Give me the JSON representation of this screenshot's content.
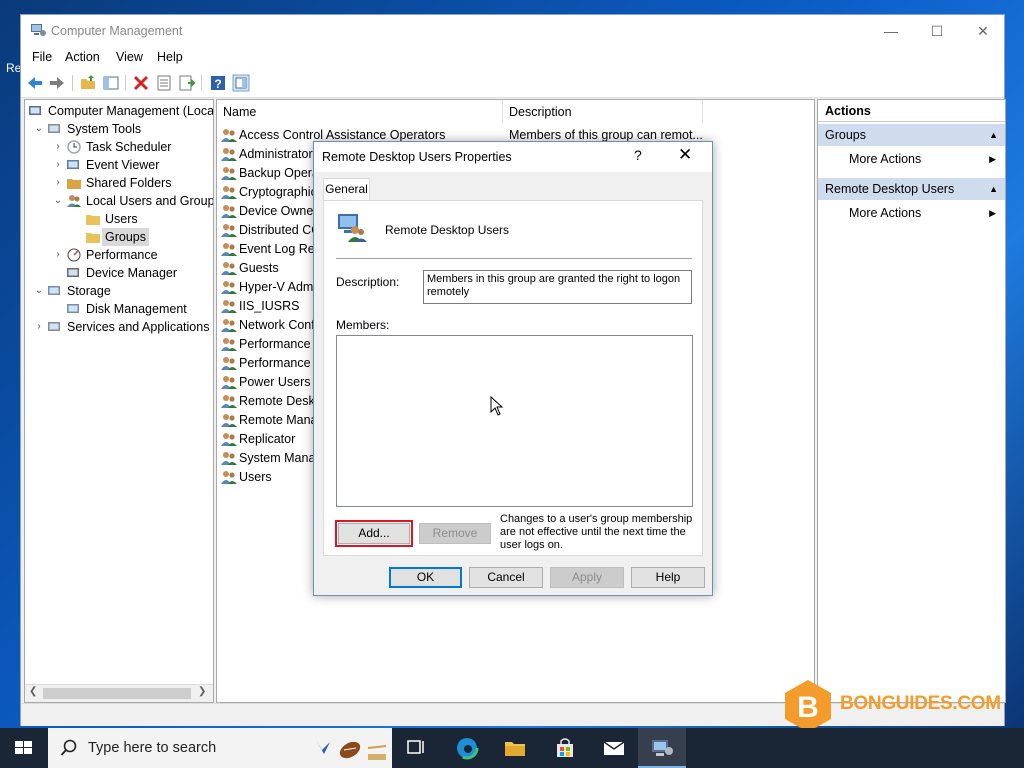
{
  "window": {
    "title": "Computer Management",
    "controls": {
      "minimize": "—",
      "maximize": "☐",
      "close": "✕"
    }
  },
  "menu": [
    "File",
    "Action",
    "View",
    "Help"
  ],
  "tree": [
    {
      "label": "Computer Management (Local",
      "level": 0,
      "expander": "",
      "icon": "computer-management-icon"
    },
    {
      "label": "System Tools",
      "level": 1,
      "expander": "⌄",
      "icon": "tools-icon"
    },
    {
      "label": "Task Scheduler",
      "level": 2,
      "expander": "›",
      "icon": "clock-icon"
    },
    {
      "label": "Event Viewer",
      "level": 2,
      "expander": "›",
      "icon": "event-viewer-icon"
    },
    {
      "label": "Shared Folders",
      "level": 2,
      "expander": "›",
      "icon": "shared-folder-icon"
    },
    {
      "label": "Local Users and Groups",
      "level": 2,
      "expander": "⌄",
      "icon": "users-icon"
    },
    {
      "label": "Users",
      "level": 3,
      "expander": "",
      "icon": "folder-icon"
    },
    {
      "label": "Groups",
      "level": 3,
      "expander": "",
      "icon": "folder-icon",
      "selected": true
    },
    {
      "label": "Performance",
      "level": 2,
      "expander": "›",
      "icon": "performance-icon"
    },
    {
      "label": "Device Manager",
      "level": 2,
      "expander": "",
      "icon": "device-manager-icon"
    },
    {
      "label": "Storage",
      "level": 1,
      "expander": "⌄",
      "icon": "storage-icon"
    },
    {
      "label": "Disk Management",
      "level": 2,
      "expander": "",
      "icon": "disk-icon"
    },
    {
      "label": "Services and Applications",
      "level": 1,
      "expander": "›",
      "icon": "services-icon"
    }
  ],
  "list": {
    "columns": [
      "Name",
      "Description"
    ],
    "rows": [
      {
        "name": "Access Control Assistance Operators",
        "description": "Members of this group can remot..."
      },
      {
        "name": "Administrators",
        "description": ""
      },
      {
        "name": "Backup Operat",
        "description": ""
      },
      {
        "name": "Cryptographic",
        "description": ""
      },
      {
        "name": "Device Owners",
        "description": ""
      },
      {
        "name": "Distributed CO",
        "description": ""
      },
      {
        "name": "Event Log Rea",
        "description": ""
      },
      {
        "name": "Guests",
        "description": ""
      },
      {
        "name": "Hyper-V Admi",
        "description": ""
      },
      {
        "name": "IIS_IUSRS",
        "description": ""
      },
      {
        "name": "Network Confi",
        "description": ""
      },
      {
        "name": "Performance L",
        "description": ""
      },
      {
        "name": "Performance M",
        "description": ""
      },
      {
        "name": "Power Users",
        "description": ""
      },
      {
        "name": "Remote Deskto",
        "description": ""
      },
      {
        "name": "Remote Manag",
        "description": ""
      },
      {
        "name": "Replicator",
        "description": ""
      },
      {
        "name": "System Manag",
        "description": ""
      },
      {
        "name": "Users",
        "description": ""
      }
    ]
  },
  "actions": {
    "header": "Actions",
    "sections": [
      {
        "title": "Groups",
        "item": "More Actions"
      },
      {
        "title": "Remote Desktop Users",
        "item": "More Actions"
      }
    ]
  },
  "dialog": {
    "title": "Remote Desktop Users Properties",
    "help": "?",
    "close": "✕",
    "tab": "General",
    "group_name": "Remote Desktop Users",
    "description_label": "Description:",
    "description_value": "Members in this group are granted the right to logon remotely",
    "members_label": "Members:",
    "add_button": "Add...",
    "remove_button": "Remove",
    "note": "Changes to a user's group membership are not effective until the next time the user logs on.",
    "ok": "OK",
    "cancel": "Cancel",
    "apply": "Apply",
    "help_button": "Help"
  },
  "taskbar": {
    "search_placeholder": "Type here to search"
  },
  "watermark": "BONGUIDES.COM",
  "colors": {
    "selection": "#d9d9d9",
    "actions_section": "#cfdcee",
    "highlight_outline": "#e0141e",
    "watermark": "#f39c2b"
  }
}
